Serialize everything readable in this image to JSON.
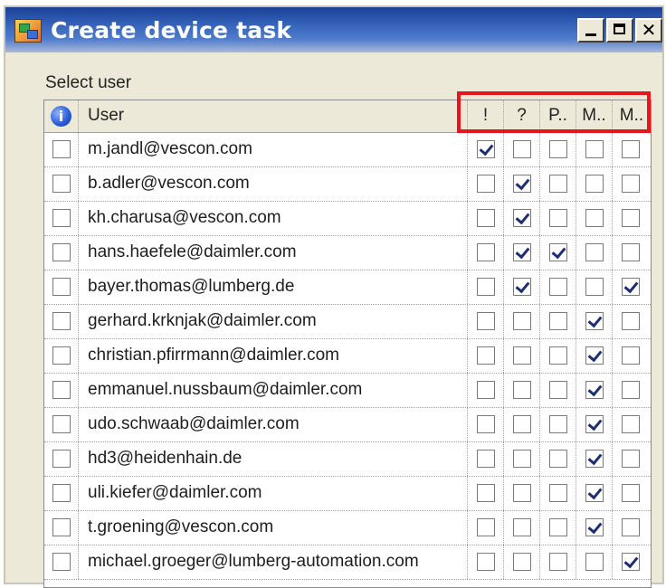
{
  "window": {
    "title": "Create device task",
    "icon": "app-icon",
    "buttons": {
      "minimize": "minimize",
      "maximize": "maximize",
      "close": "✕"
    }
  },
  "label": "Select user",
  "table": {
    "header_icon": "info-icon",
    "header_icon_glyph": "i",
    "columns": [
      "User",
      "!",
      "?",
      "P..",
      "M..",
      "M.."
    ],
    "rows": [
      {
        "user": "m.jandl@vescon.com",
        "selected": false,
        "flags": [
          true,
          false,
          false,
          false,
          false
        ]
      },
      {
        "user": "b.adler@vescon.com",
        "selected": false,
        "flags": [
          false,
          true,
          false,
          false,
          false
        ]
      },
      {
        "user": "kh.charusa@vescon.com",
        "selected": false,
        "flags": [
          false,
          true,
          false,
          false,
          false
        ]
      },
      {
        "user": "hans.haefele@daimler.com",
        "selected": false,
        "flags": [
          false,
          true,
          true,
          false,
          false
        ]
      },
      {
        "user": "bayer.thomas@lumberg.de",
        "selected": false,
        "flags": [
          false,
          true,
          false,
          false,
          true
        ]
      },
      {
        "user": "gerhard.krknjak@daimler.com",
        "selected": false,
        "flags": [
          false,
          false,
          false,
          true,
          false
        ]
      },
      {
        "user": "christian.pfirrmann@daimler.com",
        "selected": false,
        "flags": [
          false,
          false,
          false,
          true,
          false
        ]
      },
      {
        "user": "emmanuel.nussbaum@daimler.com",
        "selected": false,
        "flags": [
          false,
          false,
          false,
          true,
          false
        ]
      },
      {
        "user": "udo.schwaab@daimler.com",
        "selected": false,
        "flags": [
          false,
          false,
          false,
          true,
          false
        ]
      },
      {
        "user": "hd3@heidenhain.de",
        "selected": false,
        "flags": [
          false,
          false,
          false,
          true,
          false
        ]
      },
      {
        "user": "uli.kiefer@daimler.com",
        "selected": false,
        "flags": [
          false,
          false,
          false,
          true,
          false
        ]
      },
      {
        "user": "t.groening@vescon.com",
        "selected": false,
        "flags": [
          false,
          false,
          false,
          true,
          false
        ]
      },
      {
        "user": "michael.groeger@lumberg-automation.com",
        "selected": false,
        "flags": [
          false,
          false,
          false,
          false,
          true
        ]
      }
    ]
  },
  "colors": {
    "title_gradient_dark": "#1a3f96",
    "highlight": "#e8161c",
    "check": "#1c2e74"
  }
}
